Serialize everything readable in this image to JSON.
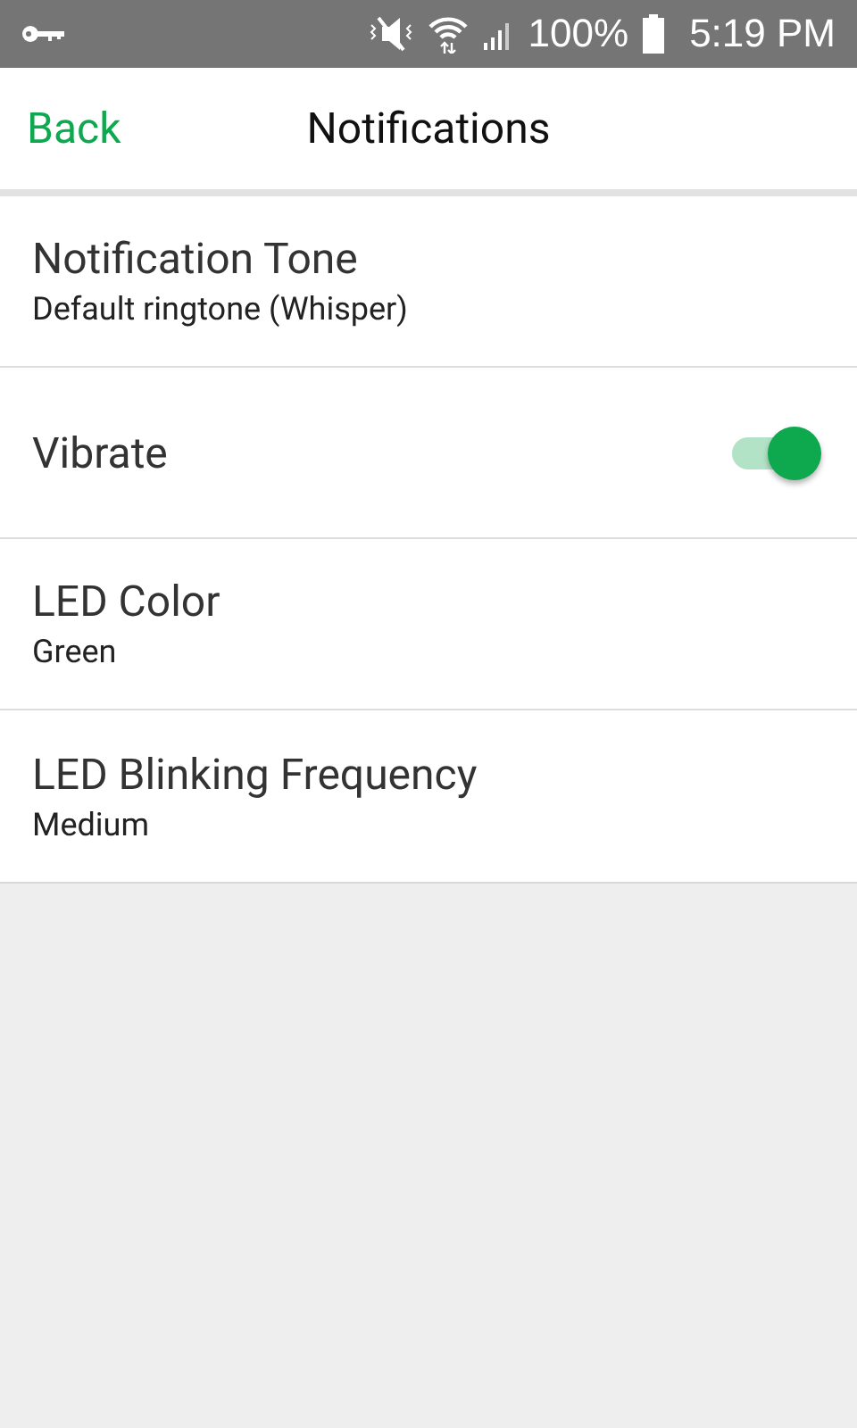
{
  "status_bar": {
    "battery": "100%",
    "time": "5:19 PM"
  },
  "header": {
    "back": "Back",
    "title": "Notifications"
  },
  "settings": [
    {
      "kind": "detail",
      "title": "Notification Tone",
      "value": "Default ringtone (Whisper)"
    },
    {
      "kind": "toggle",
      "title": "Vibrate",
      "on": true
    },
    {
      "kind": "detail",
      "title": "LED Color",
      "value": "Green"
    },
    {
      "kind": "detail",
      "title": "LED Blinking Frequency",
      "value": "Medium"
    }
  ]
}
